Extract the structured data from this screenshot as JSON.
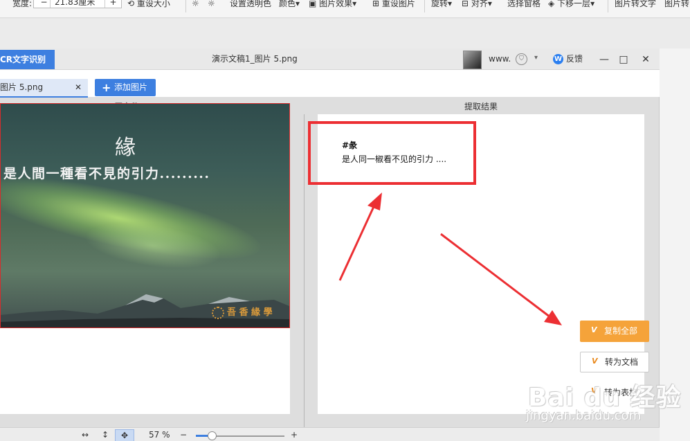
{
  "ribbon": {
    "width_label": "宽度:",
    "width_value": "21.83厘米",
    "reset_size": "重设大小",
    "set_transparent": "设置透明色",
    "color": "颜色",
    "picture_effects": "图片效果",
    "reset_picture": "重设图片",
    "rotate": "旋转",
    "align": "对齐",
    "selection_pane": "选择窗格",
    "send_backward": "下移一层",
    "picture_to_text": "图片转文字",
    "picture_to_more": "图片转"
  },
  "dialog": {
    "tab_label": "CR文字识别",
    "window_title": "演示文稿1_图片 5.png",
    "user_name": "www.",
    "feedback": "反馈",
    "minimize": "—",
    "maximize": "□",
    "close": "✕"
  },
  "files": {
    "tab_name": "图片 5.png",
    "close": "✕",
    "add_button": "添加图片",
    "add_plus": "+"
  },
  "columns": {
    "source": "原文件",
    "result": "提取结果"
  },
  "image": {
    "title_char": "緣",
    "subtitle": "是人間一種看不見的引力.........",
    "watermark": "吾 香 緣 學"
  },
  "result": {
    "line1": "#彖",
    "line2": "是人同一椒看不见的引力 ...."
  },
  "actions": {
    "copy_all": "复制全部",
    "to_doc": "转为文档",
    "to_table": "转为表格",
    "vip_badge": "V"
  },
  "bottom": {
    "fit_width_icon": "↔",
    "fit_height_icon": "↕",
    "move_icon": "✥",
    "zoom_value": "57 %",
    "zoom_minus": "−",
    "zoom_plus": "+",
    "zoom_fraction": 0.18
  },
  "watermark": {
    "brand": "Bai du 经验",
    "url": "jingyan.baidu.com"
  },
  "colors": {
    "accent": "#3d7fe0",
    "highlight": "#ec2f33",
    "copy_button": "#f5a33a"
  }
}
